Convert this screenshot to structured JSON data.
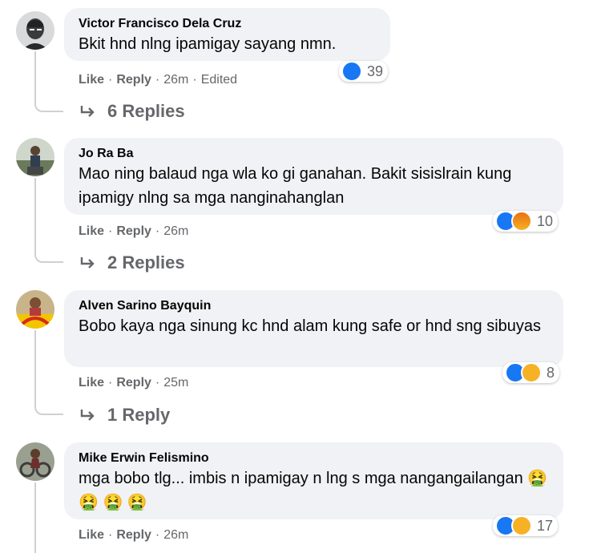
{
  "comments": [
    {
      "author": "Victor Francisco Dela Cruz",
      "text": "Bkit hnd nlng ipamigay sayang nmn.",
      "like": "Like",
      "reply": "Reply",
      "time": "26m",
      "edited": "Edited",
      "reaction_count": "39",
      "reactions": [
        "like-icon"
      ],
      "replies": "6 Replies"
    },
    {
      "author": "Jo Ra Ba",
      "text": "Mao ning balaud nga wla ko gi ganahan. Bakit sisislrain kung ipamigy nlng sa mga nanginahanglan",
      "like": "Like",
      "reply": "Reply",
      "time": "26m",
      "reaction_count": "10",
      "reactions": [
        "like-icon",
        "angry-icon"
      ],
      "replies": "2 Replies"
    },
    {
      "author": "Alven Sarino Bayquin",
      "text": "Bobo kaya nga sinung kc hnd alam kung safe or hnd sng sibuyas",
      "like": "Like",
      "reply": "Reply",
      "time": "25m",
      "reaction_count": "8",
      "reactions": [
        "like-icon",
        "haha-icon"
      ],
      "replies": "1 Reply"
    },
    {
      "author": "Mike Erwin Felismino",
      "text": "mga bobo tlg... imbis n ipamigay n lng s mga nangangailangan",
      "emoji": "🤮 🤮 🤮 🤮",
      "like": "Like",
      "reply": "Reply",
      "time": "26m",
      "reaction_count": "17",
      "reactions": [
        "like-icon",
        "haha-icon"
      ]
    }
  ],
  "colors": {
    "bubble": "#f0f2f5",
    "meta": "#65676b",
    "like": "#1877f2",
    "haha": "#f7b125"
  }
}
